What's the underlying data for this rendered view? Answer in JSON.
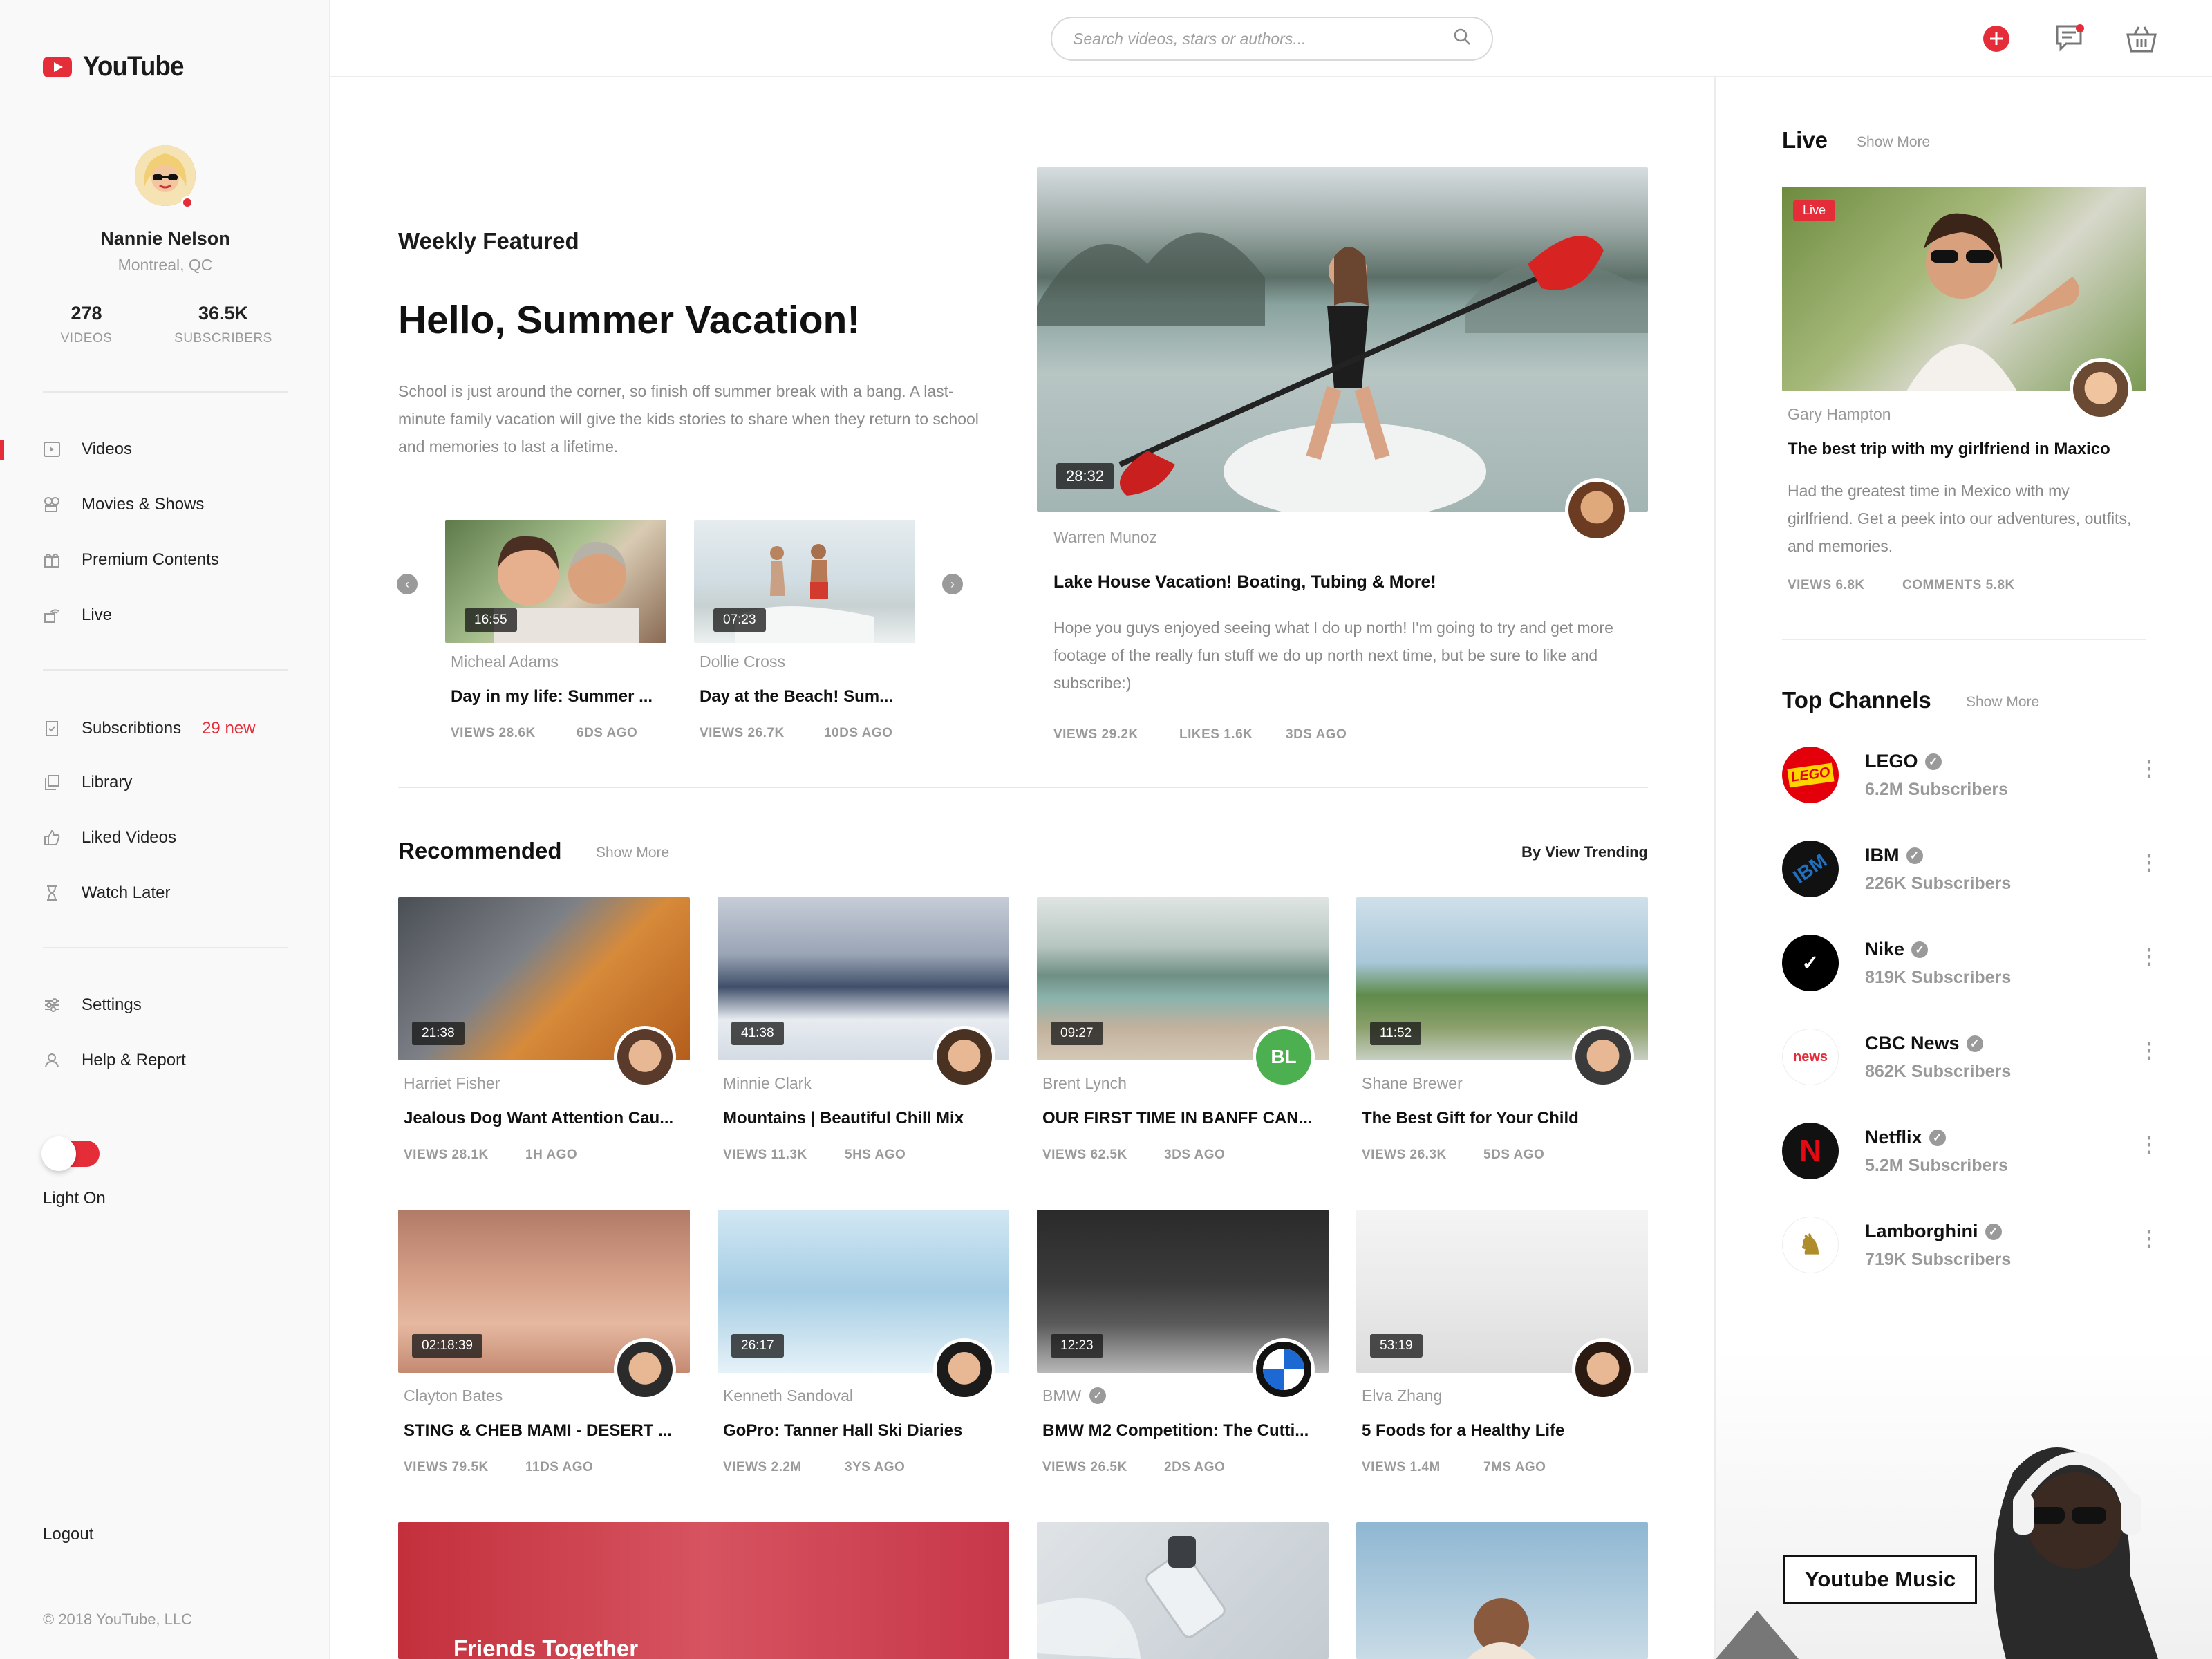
{
  "app": {
    "name": "YouTube"
  },
  "profile": {
    "name": "Nannie Nelson",
    "location": "Montreal, QC",
    "videos": "278",
    "videos_label": "VIDEOS",
    "subscribers": "36.5K",
    "subscribers_label": "SUBSCRIBERS"
  },
  "nav": {
    "main": [
      {
        "label": "Videos",
        "icon": "video-icon"
      },
      {
        "label": "Movies & Shows",
        "icon": "movies-icon"
      },
      {
        "label": "Premium Contents",
        "icon": "gift-icon"
      },
      {
        "label": "Live",
        "icon": "live-icon"
      }
    ],
    "library": [
      {
        "label": "Subscribtions",
        "badge": "29 new",
        "icon": "subscriptions-icon"
      },
      {
        "label": "Library",
        "icon": "library-icon"
      },
      {
        "label": "Liked Videos",
        "icon": "like-icon"
      },
      {
        "label": "Watch Later",
        "icon": "hourglass-icon"
      }
    ],
    "settings": [
      {
        "label": "Settings",
        "icon": "sliders-icon"
      },
      {
        "label": "Help & Report",
        "icon": "help-icon"
      }
    ],
    "light_label": "Light On",
    "logout": "Logout",
    "copyright": "© 2018 YouTube, LLC"
  },
  "search": {
    "placeholder": "Search videos, stars or authors..."
  },
  "featured": {
    "kicker": "Weekly Featured",
    "title": "Hello, Summer Vacation!",
    "text": "School is just around the corner, so finish off summer break with a bang. A last-minute family vacation will give the kids stories to share when they return to school and memories to last a lifetime.",
    "mini": [
      {
        "duration": "16:55",
        "author": "Micheal Adams",
        "title": "Day in my life: Summer ...",
        "views": "VIEWS 28.6K",
        "age": "6DS AGO"
      },
      {
        "duration": "07:23",
        "author": "Dollie Cross",
        "title": "Day at the Beach! Sum...",
        "views": "VIEWS 26.7K",
        "age": "10DS AGO"
      }
    ],
    "main": {
      "duration": "28:32",
      "author": "Warren Munoz",
      "title": "Lake House Vacation! Boating, Tubing & More!",
      "text": "Hope you guys enjoyed seeing what I do up north! I'm going to try and get more footage of the really fun stuff we do up north next time, but be sure to like and subscribe:)",
      "views": "VIEWS 29.2K",
      "likes": "LIKES 1.6K",
      "age": "3DS AGO"
    }
  },
  "recommended": {
    "title": "Recommended",
    "show_more": "Show More",
    "sort": "By View Trending",
    "videos": [
      {
        "duration": "21:38",
        "author": "Harriet Fisher",
        "title": "Jealous Dog Want Attention Cau...",
        "views": "VIEWS 28.1K",
        "age": "1H AGO"
      },
      {
        "duration": "41:38",
        "author": "Minnie Clark",
        "title": "Mountains | Beautiful Chill Mix",
        "views": "VIEWS 11.3K",
        "age": "5HS AGO"
      },
      {
        "duration": "09:27",
        "author": "Brent Lynch",
        "title": "OUR FIRST TIME IN BANFF CAN...",
        "views": "VIEWS 62.5K",
        "age": "3DS AGO",
        "initials": "BL"
      },
      {
        "duration": "11:52",
        "author": "Shane Brewer",
        "title": "The Best Gift for Your Child",
        "views": "VIEWS 26.3K",
        "age": "5DS AGO"
      },
      {
        "duration": "02:18:39",
        "author": "Clayton Bates",
        "title": "STING & CHEB MAMI - DESERT ...",
        "views": "VIEWS 79.5K",
        "age": "11DS AGO"
      },
      {
        "duration": "26:17",
        "author": "Kenneth Sandoval",
        "title": "GoPro: Tanner Hall Ski Diaries",
        "views": "VIEWS 2.2M",
        "age": "3YS AGO"
      },
      {
        "duration": "12:23",
        "author": "BMW",
        "title": "BMW M2 Competition: The Cutti...",
        "views": "VIEWS 26.5K",
        "age": "2DS AGO"
      },
      {
        "duration": "53:19",
        "author": "Elva Zhang",
        "title": "5 Foods for a Healthy Life",
        "views": "VIEWS 1.4M",
        "age": "7MS AGO"
      }
    ],
    "banner": "Friends Together"
  },
  "live": {
    "title": "Live",
    "show_more": "Show More",
    "badge": "Live",
    "author": "Gary Hampton",
    "video_title": "The best trip with my girlfriend in Maxico",
    "text": "Had the greatest time in Mexico with my girlfriend. Get a peek into our adventures, outfits, and memories.",
    "views": "VIEWS 6.8K",
    "comments": "COMMENTS 5.8K"
  },
  "channels": {
    "title": "Top Channels",
    "show_more": "Show More",
    "items": [
      {
        "name": "LEGO",
        "subs": "6.2M Subscribers",
        "color": "#e3000b",
        "mark": "LEGO"
      },
      {
        "name": "IBM",
        "subs": "226K Subscribers",
        "color": "#111111",
        "mark": "IBM"
      },
      {
        "name": "Nike",
        "subs": "819K Subscribers",
        "color": "#000000",
        "mark": "✓"
      },
      {
        "name": "CBC News",
        "subs": "862K Subscribers",
        "color": "#ffffff",
        "mark": "news"
      },
      {
        "name": "Netflix",
        "subs": "5.2M Subscribers",
        "color": "#111111",
        "mark": "N"
      },
      {
        "name": "Lamborghini",
        "subs": "719K Subscribers",
        "color": "#ffffff",
        "mark": "♞"
      }
    ]
  },
  "promo": {
    "label": "Youtube Music"
  },
  "colors": {
    "accent": "#e52d3a"
  }
}
